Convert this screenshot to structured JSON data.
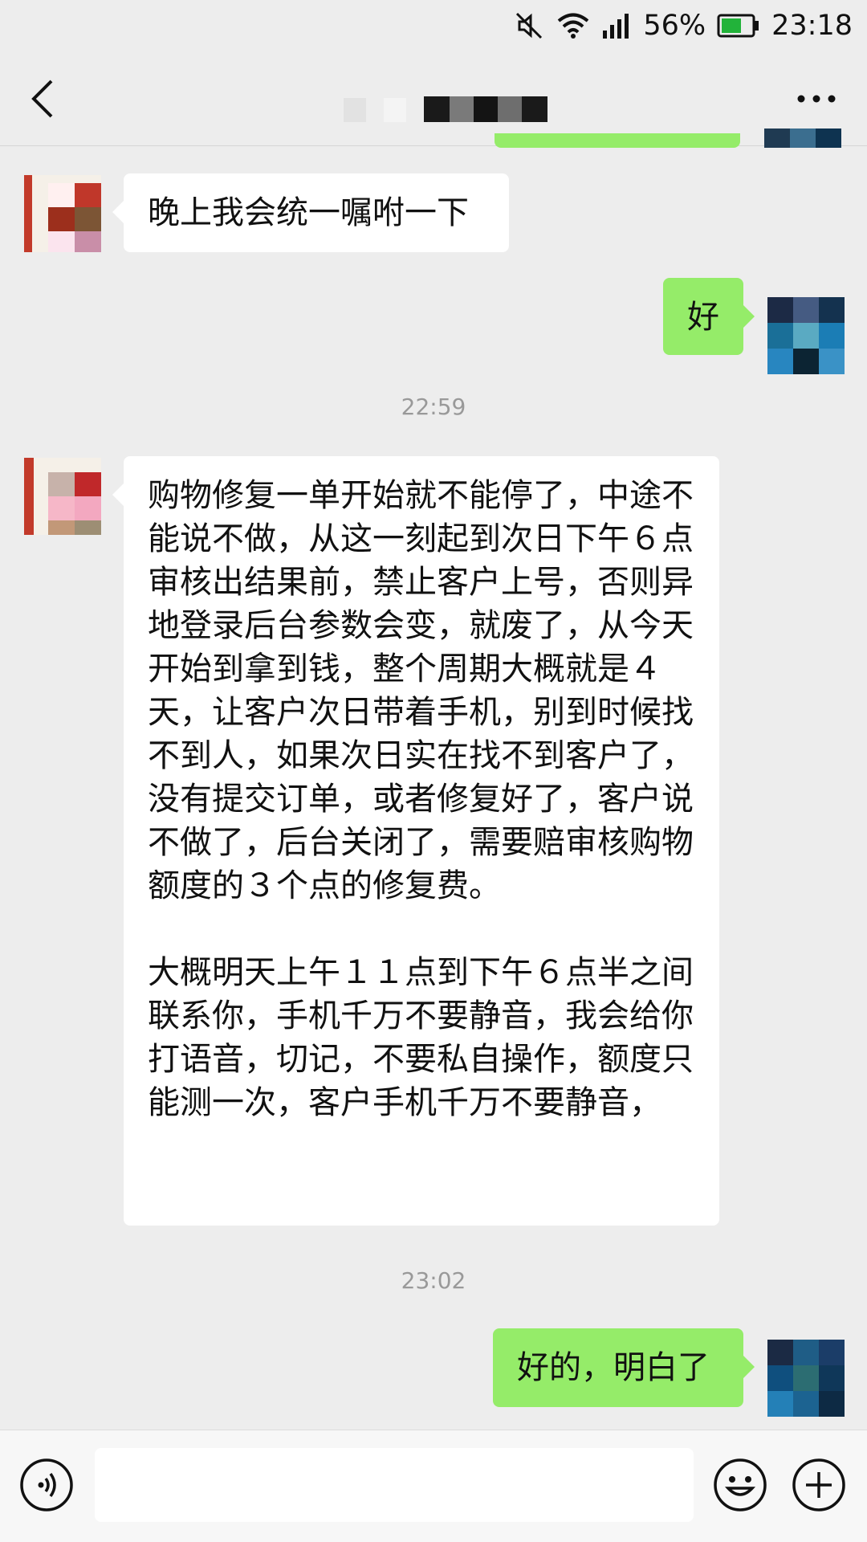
{
  "status_bar": {
    "battery_percent": "56%",
    "time": "23:18",
    "icons": [
      "mute-icon",
      "wifi-icon",
      "signal-icon",
      "battery-icon"
    ],
    "battery_color": "#22b33a"
  },
  "header": {
    "back_icon": "chevron-left-icon",
    "more_icon": "more-dots-icon"
  },
  "colors": {
    "background": "#ededed",
    "incoming_bubble": "#ffffff",
    "outgoing_bubble": "#95ec69",
    "timestamp_text": "#999999"
  },
  "messages": [
    {
      "direction": "in",
      "text": "晚上我会统一嘱咐一下"
    },
    {
      "direction": "out",
      "text": "好"
    },
    {
      "type": "timestamp",
      "text": "22:59"
    },
    {
      "direction": "in",
      "paragraphs": [
        "购物修复一单开始就不能停了，中途不能说不做，从这一刻起到次日下午６点审核出结果前，禁止客户上号，否则异地登录后台参数会变，就废了，从今天开始到拿到钱，整个周期大概就是４天，让客户次日带着手机，别到时候找不到人，如果次日实在找不到客户了，没有提交订单，或者修复好了，客户说不做了，后台关闭了，需要赔审核购物额度的３个点的修复费。",
        "大概明天上午１１点到下午６点半之间联系你，手机千万不要静音，我会给你打语音，切记，不要私自操作，额度只能测一次，客户手机千万不要静音，"
      ]
    },
    {
      "type": "timestamp",
      "text": "23:02"
    },
    {
      "direction": "out",
      "text": "好的，明白了"
    }
  ],
  "input_bar": {
    "voice_icon": "voice-icon",
    "input_value": "",
    "emoji_icon": "emoji-icon",
    "plus_icon": "plus-icon"
  }
}
